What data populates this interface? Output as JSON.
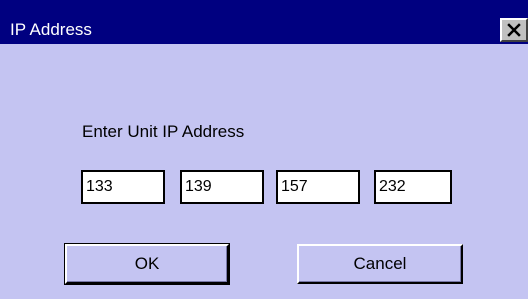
{
  "window": {
    "title": "IP Address",
    "close_icon": "close-x-icon"
  },
  "dialog": {
    "prompt": "Enter Unit IP Address",
    "ip_octets": [
      "133",
      "139",
      "157",
      "232"
    ],
    "ok_label": "OK",
    "cancel_label": "Cancel"
  },
  "colors": {
    "titlebar": "#000080",
    "dialog_background": "#c4c4f2",
    "field_background": "#ffffff"
  }
}
